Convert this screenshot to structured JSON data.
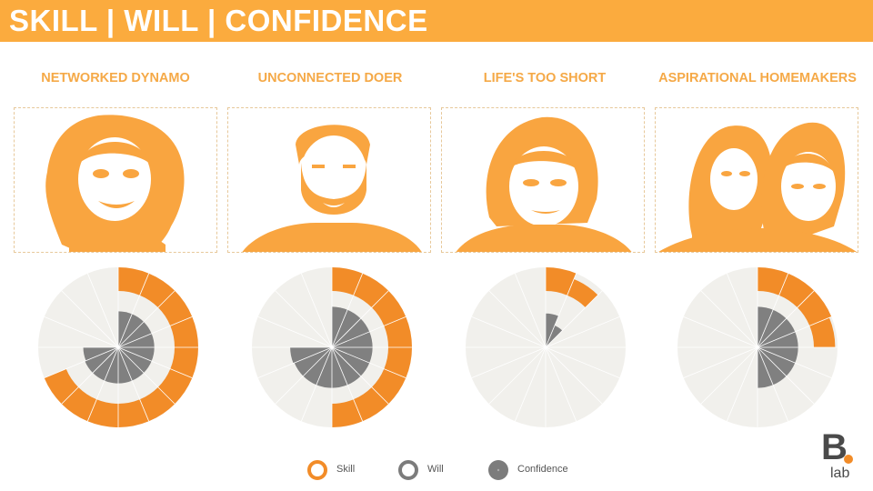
{
  "header": {
    "title": "SKILL | WILL | CONFIDENCE"
  },
  "colors": {
    "header_bg": "#fbab3e",
    "title_text": "#f5a947",
    "photo_fill": "#f9a540",
    "skill": "#f28c28",
    "will_bg": "#f1f0ec",
    "will_line": "#8a8a8a",
    "confidence": "#808080",
    "separator": "#ffffff"
  },
  "segments": [
    {
      "title": "NETWORKED DYNAMO"
    },
    {
      "title": "UNCONNECTED DOER"
    },
    {
      "title": "LIFE'S TOO SHORT"
    },
    {
      "title": "ASPIRATIONAL HOMEMAKERS"
    }
  ],
  "chart_data": [
    {
      "type": "polar-bar",
      "segment": "NETWORKED DYNAMO",
      "series": [
        {
          "name": "Skill",
          "values": [
            1,
            1,
            1,
            1,
            1,
            1,
            1,
            1,
            1,
            1,
            1,
            0,
            0,
            0,
            0,
            0
          ]
        },
        {
          "name": "Will",
          "values": [
            1,
            1,
            1,
            1,
            1,
            1,
            1,
            1,
            1,
            1,
            1,
            1,
            1,
            1,
            1,
            1
          ]
        },
        {
          "name": "Confidence",
          "values": [
            0.64,
            0.64,
            0.64,
            0.64,
            0.64,
            0.64,
            0.64,
            0.64,
            0.64,
            0.64,
            0.64,
            0.62,
            0,
            0,
            0,
            0
          ]
        }
      ]
    },
    {
      "type": "polar-bar",
      "segment": "UNCONNECTED DOER",
      "series": [
        {
          "name": "Skill",
          "values": [
            1,
            1,
            1,
            1,
            1,
            1,
            1,
            1,
            0,
            0,
            0,
            0,
            0,
            0,
            0,
            0
          ]
        },
        {
          "name": "Will",
          "values": [
            1,
            1,
            1,
            1,
            1,
            1,
            1,
            1,
            1,
            1,
            1,
            1,
            1,
            1,
            1,
            1
          ]
        },
        {
          "name": "Confidence",
          "values": [
            0.72,
            0.72,
            0.72,
            0.72,
            0.72,
            0.72,
            0.72,
            0.72,
            0.72,
            0.72,
            0.72,
            0.74,
            0,
            0,
            0,
            0
          ]
        }
      ]
    },
    {
      "type": "polar-bar",
      "segment": "LIFE'S TOO SHORT",
      "series": [
        {
          "name": "Skill",
          "values": [
            1,
            0.74,
            0,
            0,
            0,
            0,
            0,
            0,
            0,
            0,
            0,
            0,
            0,
            0,
            0,
            0
          ]
        },
        {
          "name": "Will",
          "values": [
            1,
            1,
            1,
            1,
            1,
            1,
            1,
            1,
            1,
            1,
            1,
            1,
            1,
            1,
            1,
            1
          ]
        },
        {
          "name": "Confidence",
          "values": [
            0.6,
            0.42,
            0,
            0,
            0,
            0,
            0,
            0,
            0,
            0,
            0,
            0,
            0,
            0,
            0,
            0
          ]
        }
      ]
    },
    {
      "type": "polar-bar",
      "segment": "ASPIRATIONAL HOMEMAKERS",
      "series": [
        {
          "name": "Skill",
          "values": [
            1,
            1,
            1,
            0.9,
            0,
            0,
            0,
            0,
            0,
            0,
            0,
            0,
            0,
            0,
            0,
            0
          ]
        },
        {
          "name": "Will",
          "values": [
            1,
            1,
            1,
            1,
            1,
            1,
            1,
            1,
            1,
            1,
            1,
            1,
            1,
            1,
            1,
            1
          ]
        },
        {
          "name": "Confidence",
          "values": [
            0.72,
            0.72,
            0.72,
            0.72,
            0.72,
            0.72,
            0.72,
            0.72,
            0,
            0,
            0,
            0,
            0,
            0,
            0,
            0
          ]
        }
      ]
    }
  ],
  "legend": [
    {
      "label": "Skill",
      "icon": "ring-icon"
    },
    {
      "label": "Will",
      "icon": "ring-icon"
    },
    {
      "label": "Confidence",
      "icon": "disc-icon"
    }
  ],
  "logo": {
    "letter": "B",
    "word": "lab"
  }
}
